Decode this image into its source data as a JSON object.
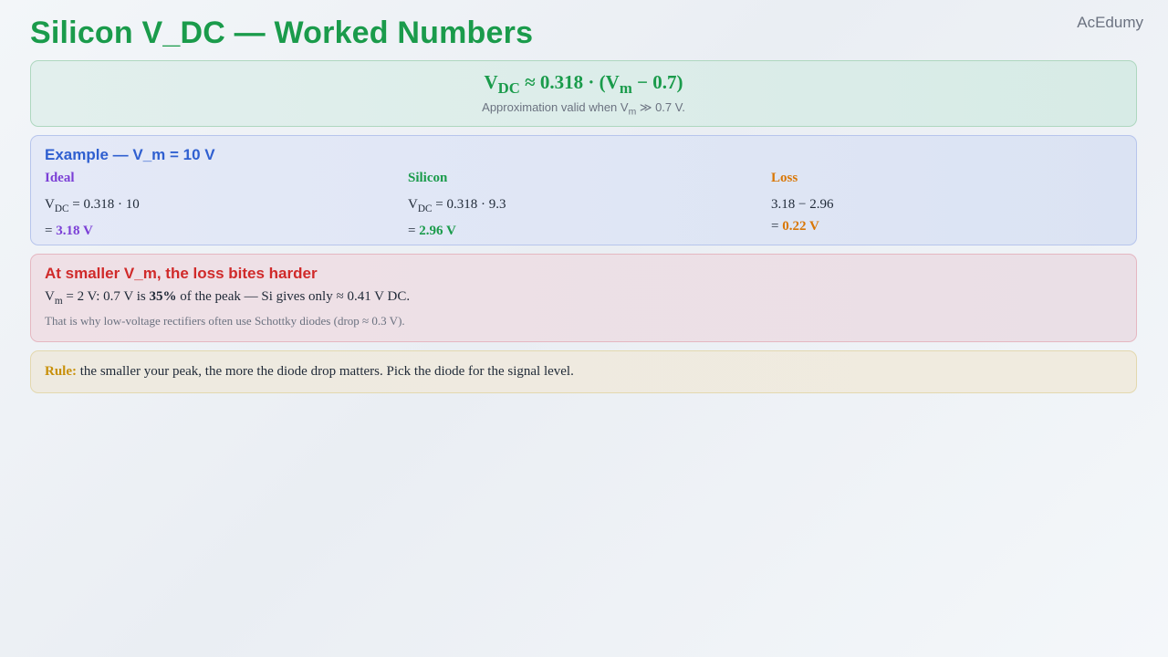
{
  "brand": "AcEdumy",
  "title": "Silicon V_DC — Worked Numbers",
  "formula": {
    "lhs": "V",
    "lhs_sub": "DC",
    "mid": " ≈ 0.318 · (V",
    "vm_sub": "m",
    "rhs": " − 0.7)",
    "note_pre": "Approximation valid when V",
    "note_sub": "m",
    "note_post": " ≫ 0.7 V."
  },
  "example": {
    "heading": "Example — V_m = 10 V",
    "ideal": {
      "label": "Ideal",
      "line1_v": "V",
      "line1_sub": "DC",
      "line1_rest": " = 0.318 · 10",
      "eq_prefix": "= ",
      "result": "3.18 V"
    },
    "silicon": {
      "label": "Silicon",
      "line1_v": "V",
      "line1_sub": "DC",
      "line1_rest": " = 0.318 · 9.3",
      "eq_prefix": "= ",
      "result": "2.96 V"
    },
    "loss": {
      "label": "Loss",
      "line1": "3.18 − 2.96",
      "eq_prefix": "= ",
      "result": "0.22 V"
    }
  },
  "warning": {
    "heading": "At smaller V_m, the loss bites harder",
    "line_v": "V",
    "line_sub": "m",
    "line_a": " = 2 V: 0.7 V is ",
    "line_bold": "35%",
    "line_b": " of the peak — Si gives only ≈ 0.41 V DC.",
    "note": "That is why low-voltage rectifiers often use Schottky diodes (drop ≈ 0.3 V)."
  },
  "rule": {
    "label": "Rule:",
    "text": " the smaller your peak, the more the diode drop matters. Pick the diode for the signal level."
  }
}
